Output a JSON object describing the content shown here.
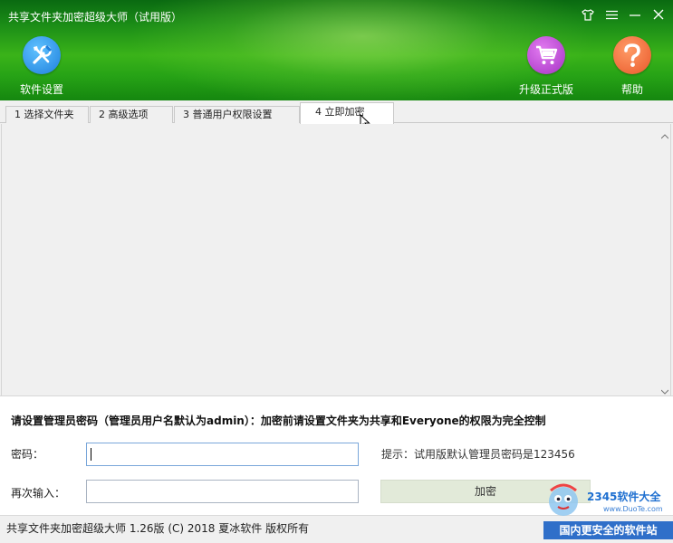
{
  "window": {
    "title": "共享文件夹加密超级大师（试用版）",
    "controls": {
      "skin_icon": "tshirt-icon",
      "menu_icon": "menu-icon",
      "minimize_icon": "minimize-icon",
      "close_icon": "close-icon"
    }
  },
  "toolbar": {
    "settings_label": "软件设置",
    "settings_icon": "tools-icon",
    "upgrade_label": "升级正式版",
    "upgrade_icon": "cart-icon",
    "help_label": "帮助",
    "help_icon": "question-icon"
  },
  "tabs": [
    {
      "label": "1 选择文件夹"
    },
    {
      "label": "2 高级选项"
    },
    {
      "label": "3 普通用户权限设置"
    },
    {
      "label": "4 立即加密",
      "active": true
    }
  ],
  "form": {
    "notice": "请设置管理员密码（管理员用户名默认为admin）：加密前请设置文件夹为共享和Everyone的权限为完全控制",
    "password_label": "密码：",
    "password_value": "",
    "confirm_label": "再次输入：",
    "confirm_value": "",
    "hint": "提示：试用版默认管理员密码是123456",
    "encrypt_button": "加密"
  },
  "status": {
    "text": "共享文件夹加密超级大师 1.26版 (C) 2018 夏冰软件 版权所有"
  },
  "watermark": {
    "brand": "2345软件大全",
    "url": "www.DuoTe.com",
    "slogan": "国内更安全的软件站"
  },
  "colors": {
    "header_green": "#2aa317",
    "settings_blue": "#1e7fdc",
    "upgrade_purple": "#a532c4",
    "help_orange": "#e9582a",
    "encrypt_button_bg": "#e2ead9"
  }
}
